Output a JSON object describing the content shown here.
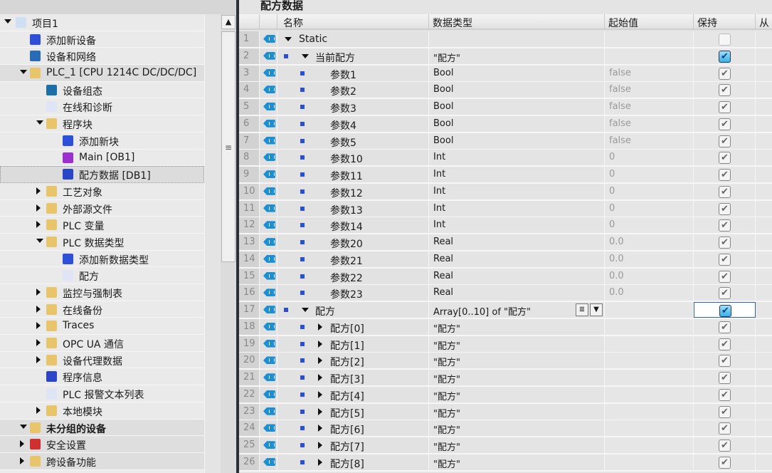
{
  "tree": [
    {
      "label": "项目1",
      "level": 0,
      "expand": "down",
      "icon": "project-icon",
      "color": "#cfe0f5"
    },
    {
      "label": "添加新设备",
      "level": 1,
      "expand": "",
      "icon": "add-device-icon",
      "color": "#2e4fd8"
    },
    {
      "label": "设备和网络",
      "level": 1,
      "expand": "",
      "icon": "network-icon",
      "color": "#2a6bb8"
    },
    {
      "label": "PLC_1 [CPU 1214C DC/DC/DC]",
      "level": 1,
      "expand": "down",
      "icon": "plc-folder-icon",
      "color": "#e8c46a",
      "hl": true
    },
    {
      "label": "设备组态",
      "level": 2,
      "expand": "",
      "icon": "device-config-icon",
      "color": "#1d6fa8"
    },
    {
      "label": "在线和诊断",
      "level": 2,
      "expand": "",
      "icon": "online-diagnostics-icon",
      "color": "#dfe5f5"
    },
    {
      "label": "程序块",
      "level": 2,
      "expand": "down",
      "icon": "program-blocks-folder-icon",
      "color": "#e8c46a"
    },
    {
      "label": "添加新块",
      "level": 3,
      "expand": "",
      "icon": "add-block-icon",
      "color": "#2e4fd8"
    },
    {
      "label": "Main [OB1]",
      "level": 3,
      "expand": "",
      "icon": "ob-icon",
      "color": "#9b2fd0"
    },
    {
      "label": "配方数据 [DB1]",
      "level": 3,
      "expand": "",
      "icon": "db-icon",
      "color": "#2a45c8",
      "sel": true
    },
    {
      "label": "工艺对象",
      "level": 2,
      "expand": "right",
      "icon": "technology-objects-folder-icon",
      "color": "#e8c46a"
    },
    {
      "label": "外部源文件",
      "level": 2,
      "expand": "right",
      "icon": "external-sources-folder-icon",
      "color": "#e8c46a"
    },
    {
      "label": "PLC 变量",
      "level": 2,
      "expand": "right",
      "icon": "plc-tags-folder-icon",
      "color": "#e8c46a"
    },
    {
      "label": "PLC 数据类型",
      "level": 2,
      "expand": "down",
      "icon": "plc-datatypes-folder-icon",
      "color": "#e8c46a"
    },
    {
      "label": "添加新数据类型",
      "level": 3,
      "expand": "",
      "icon": "add-datatype-icon",
      "color": "#2e4fd8"
    },
    {
      "label": "配方",
      "level": 3,
      "expand": "",
      "icon": "udt-icon",
      "color": "#dfe5f5"
    },
    {
      "label": "监控与强制表",
      "level": 2,
      "expand": "right",
      "icon": "watch-tables-folder-icon",
      "color": "#e8c46a"
    },
    {
      "label": "在线备份",
      "level": 2,
      "expand": "right",
      "icon": "online-backups-folder-icon",
      "color": "#e8c46a"
    },
    {
      "label": "Traces",
      "level": 2,
      "expand": "right",
      "icon": "traces-folder-icon",
      "color": "#e8c46a"
    },
    {
      "label": "OPC UA 通信",
      "level": 2,
      "expand": "right",
      "icon": "opc-ua-folder-icon",
      "color": "#e8c46a"
    },
    {
      "label": "设备代理数据",
      "level": 2,
      "expand": "right",
      "icon": "device-proxy-folder-icon",
      "color": "#e8c46a"
    },
    {
      "label": "程序信息",
      "level": 2,
      "expand": "",
      "icon": "program-info-icon",
      "color": "#2a45c8"
    },
    {
      "label": "PLC 报警文本列表",
      "level": 2,
      "expand": "",
      "icon": "alarm-text-list-icon",
      "color": "#dfe5f5"
    },
    {
      "label": "本地模块",
      "level": 2,
      "expand": "right",
      "icon": "local-modules-folder-icon",
      "color": "#e8c46a"
    },
    {
      "label": "未分组的设备",
      "level": 0.5,
      "expand": "down",
      "icon": "ungrouped-devices-icon",
      "color": "#e8c46a",
      "bold": true,
      "hl": true
    },
    {
      "label": "安全设置",
      "level": 0.5,
      "expand": "right",
      "icon": "security-settings-icon",
      "color": "#d03030",
      "hl": true
    },
    {
      "label": "跨设备功能",
      "level": 0.5,
      "expand": "right",
      "icon": "cross-device-functions-icon",
      "color": "#e8c46a",
      "hl": true
    }
  ],
  "editor": {
    "title": "配方数据",
    "headers": {
      "name": "名称",
      "type": "数据类型",
      "start": "起始值",
      "retain": "保持",
      "from": "从"
    },
    "rows": [
      {
        "n": "1",
        "name": "Static",
        "type": "",
        "start": "",
        "retain": "empty",
        "indent": 0,
        "expand": "down",
        "bullet": false
      },
      {
        "n": "2",
        "name": "当前配方",
        "type": "\"配方\"",
        "start": "",
        "retain": "blue",
        "indent": 1,
        "expand": "down",
        "bullet": true
      },
      {
        "n": "3",
        "name": "参数1",
        "type": "Bool",
        "start": "false",
        "retain": "checked",
        "indent": 2,
        "expand": "",
        "bullet": true
      },
      {
        "n": "4",
        "name": "参数2",
        "type": "Bool",
        "start": "false",
        "retain": "checked",
        "indent": 2,
        "expand": "",
        "bullet": true
      },
      {
        "n": "5",
        "name": "参数3",
        "type": "Bool",
        "start": "false",
        "retain": "checked",
        "indent": 2,
        "expand": "",
        "bullet": true
      },
      {
        "n": "6",
        "name": "参数4",
        "type": "Bool",
        "start": "false",
        "retain": "checked",
        "indent": 2,
        "expand": "",
        "bullet": true
      },
      {
        "n": "7",
        "name": "参数5",
        "type": "Bool",
        "start": "false",
        "retain": "checked",
        "indent": 2,
        "expand": "",
        "bullet": true
      },
      {
        "n": "8",
        "name": "参数10",
        "type": "Int",
        "start": "0",
        "retain": "checked",
        "indent": 2,
        "expand": "",
        "bullet": true
      },
      {
        "n": "9",
        "name": "参数11",
        "type": "Int",
        "start": "0",
        "retain": "checked",
        "indent": 2,
        "expand": "",
        "bullet": true
      },
      {
        "n": "10",
        "name": "参数12",
        "type": "Int",
        "start": "0",
        "retain": "checked",
        "indent": 2,
        "expand": "",
        "bullet": true
      },
      {
        "n": "11",
        "name": "参数13",
        "type": "Int",
        "start": "0",
        "retain": "checked",
        "indent": 2,
        "expand": "",
        "bullet": true
      },
      {
        "n": "12",
        "name": "参数14",
        "type": "Int",
        "start": "0",
        "retain": "checked",
        "indent": 2,
        "expand": "",
        "bullet": true
      },
      {
        "n": "13",
        "name": "参数20",
        "type": "Real",
        "start": "0.0",
        "retain": "checked",
        "indent": 2,
        "expand": "",
        "bullet": true
      },
      {
        "n": "14",
        "name": "参数21",
        "type": "Real",
        "start": "0.0",
        "retain": "checked",
        "indent": 2,
        "expand": "",
        "bullet": true
      },
      {
        "n": "15",
        "name": "参数22",
        "type": "Real",
        "start": "0.0",
        "retain": "checked",
        "indent": 2,
        "expand": "",
        "bullet": true
      },
      {
        "n": "16",
        "name": "参数23",
        "type": "Real",
        "start": "0.0",
        "retain": "checked",
        "indent": 2,
        "expand": "",
        "bullet": true
      },
      {
        "n": "17",
        "name": "配方",
        "type": "Array[0..10] of \"配方\"",
        "start": "",
        "retain": "blue",
        "indent": 1,
        "expand": "down",
        "bullet": true,
        "selected": true
      },
      {
        "n": "18",
        "name": "配方[0]",
        "type": "\"配方\"",
        "start": "",
        "retain": "checked",
        "indent": 2,
        "expand": "right",
        "bullet": true
      },
      {
        "n": "19",
        "name": "配方[1]",
        "type": "\"配方\"",
        "start": "",
        "retain": "checked",
        "indent": 2,
        "expand": "right",
        "bullet": true
      },
      {
        "n": "20",
        "name": "配方[2]",
        "type": "\"配方\"",
        "start": "",
        "retain": "checked",
        "indent": 2,
        "expand": "right",
        "bullet": true
      },
      {
        "n": "21",
        "name": "配方[3]",
        "type": "\"配方\"",
        "start": "",
        "retain": "checked",
        "indent": 2,
        "expand": "right",
        "bullet": true
      },
      {
        "n": "22",
        "name": "配方[4]",
        "type": "\"配方\"",
        "start": "",
        "retain": "checked",
        "indent": 2,
        "expand": "right",
        "bullet": true
      },
      {
        "n": "23",
        "name": "配方[5]",
        "type": "\"配方\"",
        "start": "",
        "retain": "checked",
        "indent": 2,
        "expand": "right",
        "bullet": true
      },
      {
        "n": "24",
        "name": "配方[6]",
        "type": "\"配方\"",
        "start": "",
        "retain": "checked",
        "indent": 2,
        "expand": "right",
        "bullet": true
      },
      {
        "n": "25",
        "name": "配方[7]",
        "type": "\"配方\"",
        "start": "",
        "retain": "checked",
        "indent": 2,
        "expand": "right",
        "bullet": true
      },
      {
        "n": "26",
        "name": "配方[8]",
        "type": "\"配方\"",
        "start": "",
        "retain": "checked",
        "indent": 2,
        "expand": "right",
        "bullet": true
      }
    ]
  },
  "colors": {
    "accent": "#2f62c9",
    "bullet": "#2a4fcf",
    "tag": "#1b8fd6",
    "divider": "#2b2f36"
  }
}
